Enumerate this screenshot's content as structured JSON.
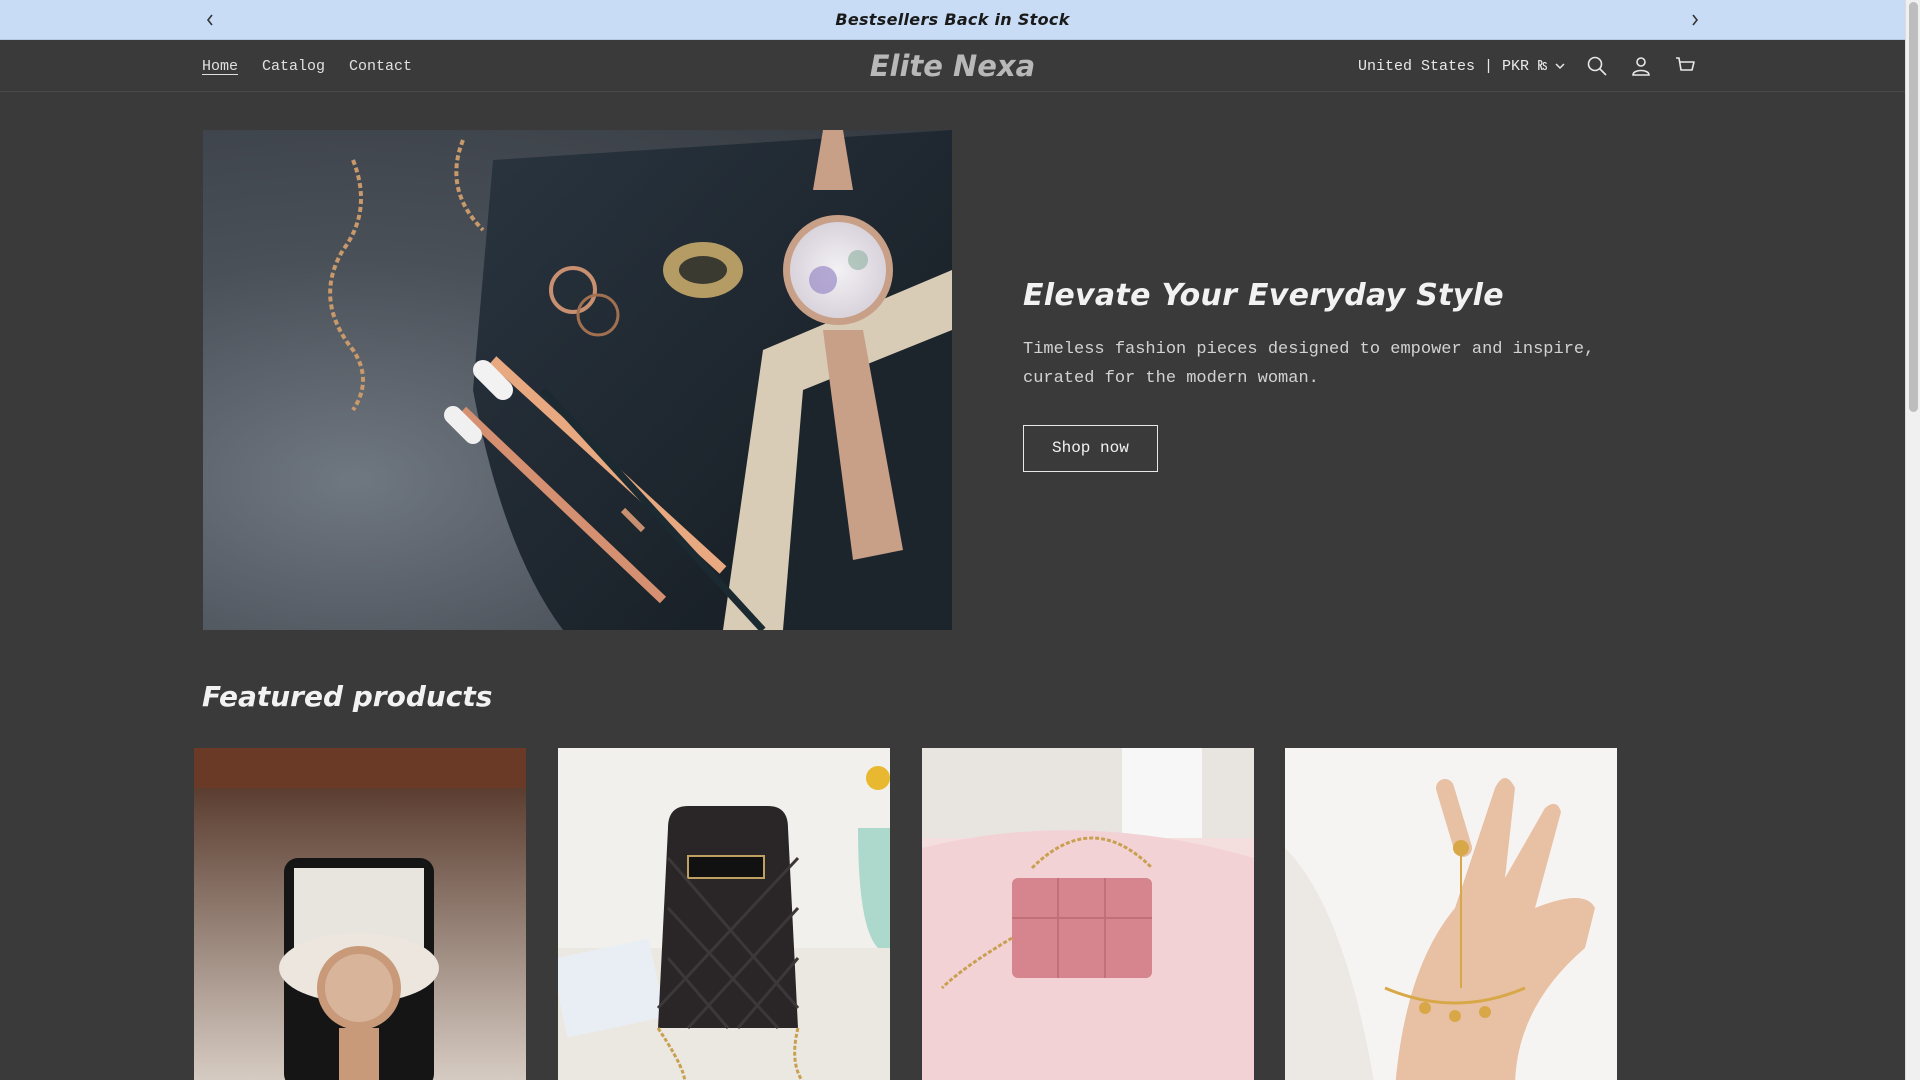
{
  "announcement": {
    "message": "Bestsellers Back in Stock",
    "prev_label": "Previous announcement",
    "next_label": "Next announcement"
  },
  "header": {
    "brand": "Elite Nexa",
    "nav": [
      {
        "label": "Home",
        "active": true
      },
      {
        "label": "Catalog",
        "active": false
      },
      {
        "label": "Contact",
        "active": false
      }
    ],
    "locale": "United States | PKR ₨",
    "icons": [
      "search-icon",
      "account-icon",
      "cart-icon"
    ]
  },
  "hero": {
    "title": "Elevate Your Everyday Style",
    "description_line1": "Timeless fashion pieces designed to empower and inspire,",
    "description_line2": "curated for the modern woman.",
    "cta": "Shop now"
  },
  "featured": {
    "title": "Featured products",
    "products": [
      {
        "image": "rose-gold-watch"
      },
      {
        "image": "black-quilted-bag"
      },
      {
        "image": "pink-quilted-bag"
      },
      {
        "image": "butterfly-hand-chain"
      }
    ]
  },
  "colors": {
    "background": "#3a3a3a",
    "announcement_bg": "#c8dcf5",
    "text": "#e8e8e8",
    "brand": "#b8b8b8"
  }
}
